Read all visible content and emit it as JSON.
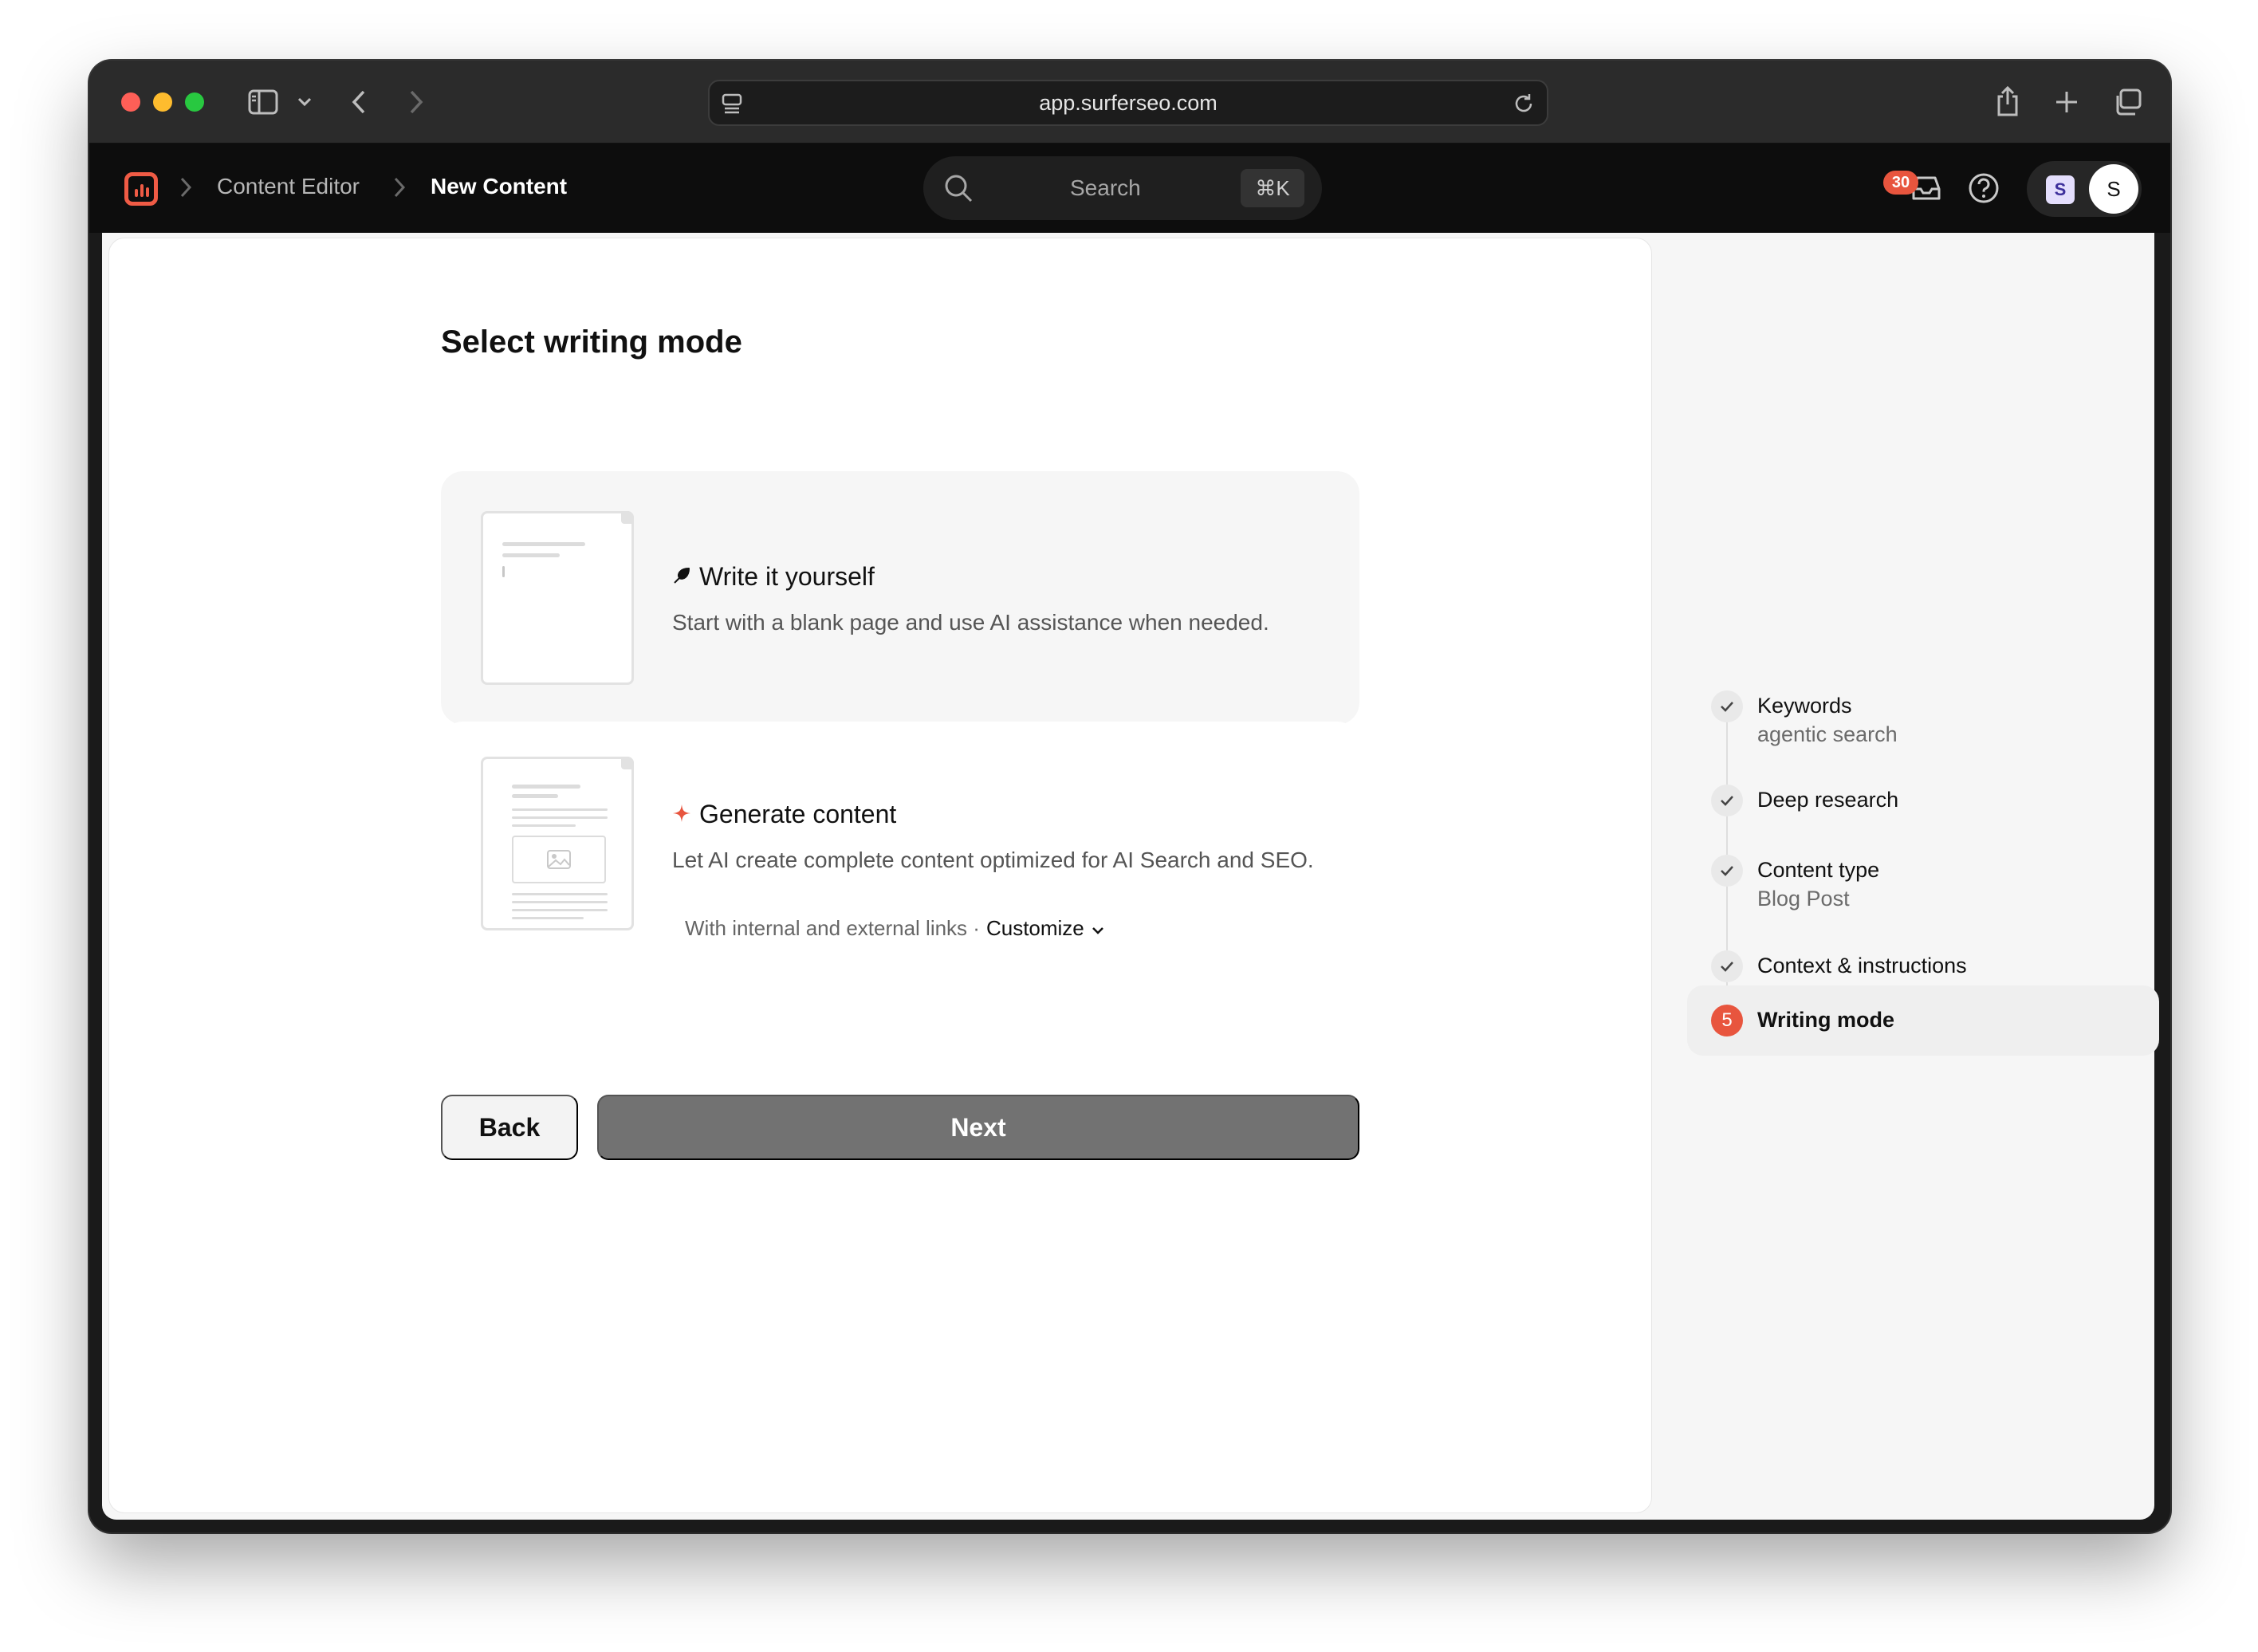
{
  "browser": {
    "url": "app.surferseo.com"
  },
  "header": {
    "breadcrumb": [
      "Content Editor",
      "New Content"
    ],
    "search_label": "Search",
    "search_shortcut": "⌘K",
    "notification_count": "30",
    "workspace_initial": "S",
    "user_initial": "S"
  },
  "main": {
    "title": "Select writing mode",
    "modes": [
      {
        "icon": "feather-icon",
        "title": "Write it yourself",
        "description": "Start with a blank page and use AI assistance when needed."
      },
      {
        "icon": "sparkle-icon",
        "title": "Generate content",
        "description": "Let AI create complete content optimized for AI Search and SEO.",
        "option_text": "With internal and external links ·",
        "option_action": "Customize"
      }
    ],
    "back_label": "Back",
    "next_label": "Next"
  },
  "steps": [
    {
      "label": "Keywords",
      "value": "agentic search",
      "status": "done"
    },
    {
      "label": "Deep research",
      "value": "",
      "status": "done"
    },
    {
      "label": "Content type",
      "value": "Blog Post",
      "status": "done"
    },
    {
      "label": "Context & instructions",
      "value": "",
      "status": "done"
    },
    {
      "label": "Writing mode",
      "number": "5",
      "status": "active"
    }
  ],
  "colors": {
    "accent": "#e8553e",
    "next_button_disabled": "#727272"
  }
}
